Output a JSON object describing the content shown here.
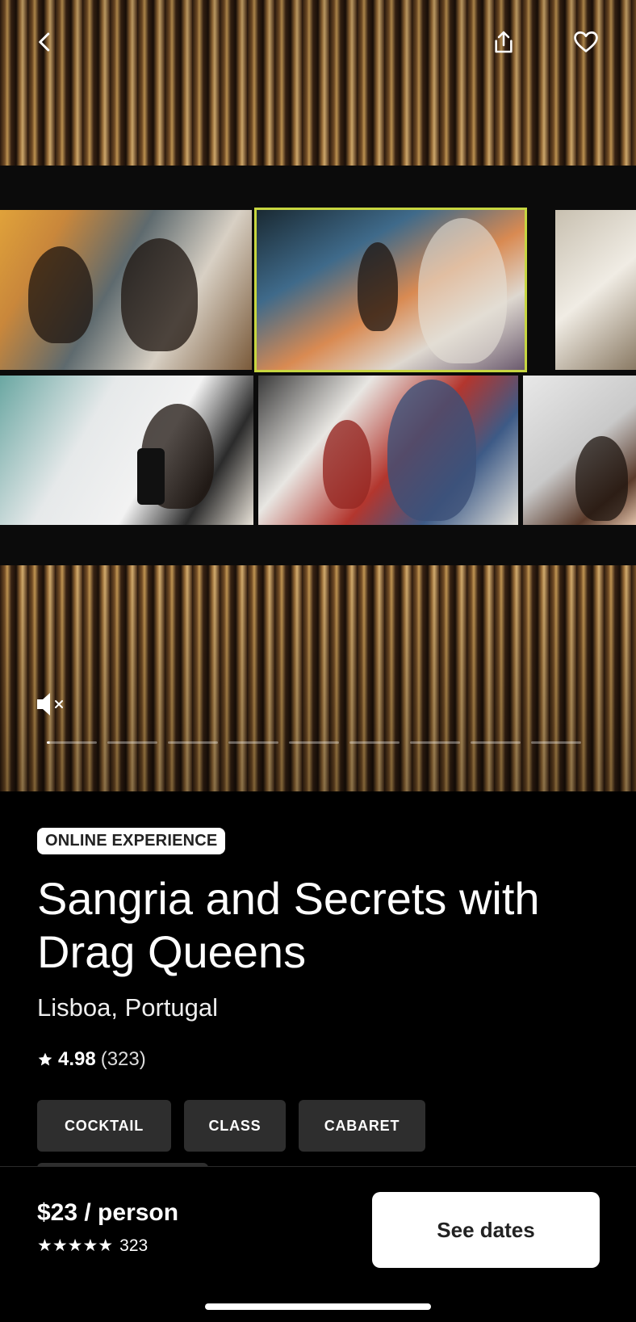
{
  "header": {
    "back_icon": "chevron-left-icon",
    "share_icon": "share-icon",
    "save_icon": "heart-icon"
  },
  "media": {
    "muted": true,
    "mute_icon": "speaker-muted-icon",
    "slide_count": 9,
    "active_slide": 1
  },
  "listing": {
    "badge": "ONLINE EXPERIENCE",
    "title": "Sangria and Secrets with Drag Queens",
    "location": "Lisboa, Portugal",
    "rating": "4.98",
    "reviews": "(323)",
    "tags": [
      "COCKTAIL",
      "CLASS",
      "CABARET"
    ]
  },
  "footer": {
    "price": "$23 / person",
    "stars": "★★★★★",
    "review_count": "323",
    "cta": "See dates"
  },
  "colors": {
    "background": "#000000",
    "tag_bg": "#2e2e2e",
    "cta_bg": "#ffffff",
    "active_tile_outline": "#c7d640"
  }
}
